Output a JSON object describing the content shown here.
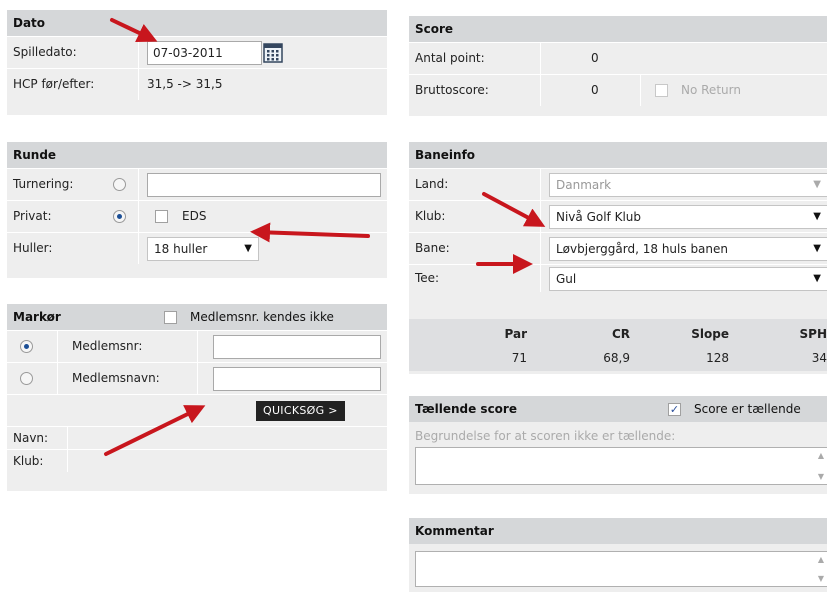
{
  "dato": {
    "header": "Dato",
    "spilledato_label": "Spilledato:",
    "spilledato_value": "07-03-2011",
    "hcp_label": "HCP før/efter:",
    "hcp_value": "31,5 -> 31,5"
  },
  "runde": {
    "header": "Runde",
    "turnering_label": "Turnering:",
    "turnering_value": "",
    "privat_label": "Privat:",
    "eds_label": "EDS",
    "huller_label": "Huller:",
    "huller_value": "18 huller"
  },
  "markor": {
    "header": "Markør",
    "unknown_label": "Medlemsnr. kendes ikke",
    "medlemsnr_label": "Medlemsnr:",
    "medlemsnr_value": "",
    "medlemsnavn_label": "Medlemsnavn:",
    "medlemsnavn_value": "",
    "quicksearch_label": "QUICKSØG >",
    "navn_label": "Navn:",
    "klub_label": "Klub:"
  },
  "score": {
    "header": "Score",
    "antal_label": "Antal point:",
    "antal_value": "0",
    "brutto_label": "Bruttoscore:",
    "brutto_value": "0",
    "noreturn_label": "No Return"
  },
  "baneinfo": {
    "header": "Baneinfo",
    "land_label": "Land:",
    "land_value": "Danmark",
    "klub_label": "Klub:",
    "klub_value": "Nivå Golf Klub",
    "bane_label": "Bane:",
    "bane_value": "Løvbjerggård, 18 huls banen",
    "tee_label": "Tee:",
    "tee_value": "Gul",
    "table_headers": [
      "Par",
      "CR",
      "Slope",
      "SPH"
    ],
    "table_values": [
      "71",
      "68,9",
      "128",
      "34"
    ]
  },
  "taellende": {
    "header": "Tællende score",
    "checkbox_label": "Score er tællende",
    "checked": "✓",
    "reason_placeholder": "Begrundelse for at scoren ikke er tællende:"
  },
  "kommentar": {
    "header": "Kommentar"
  },
  "colors": {
    "header_bg": "#d5d7d9",
    "panel_bg": "#eeeeee",
    "arrow": "#c8161d",
    "radio_selected": "#1c4f96",
    "button_bg": "#222222"
  },
  "icons": {
    "calendar": "calendar-icon",
    "dropdown": "chevron-down-icon",
    "arrow": "red-pointer-arrow"
  }
}
